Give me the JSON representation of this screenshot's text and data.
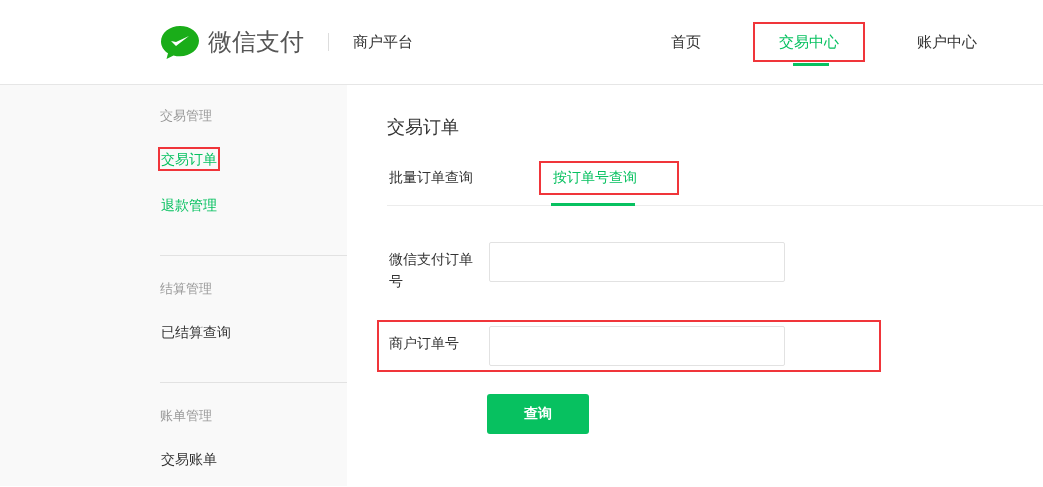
{
  "header": {
    "brand": "微信支付",
    "subtitle": "商户平台",
    "nav": [
      {
        "label": "首页",
        "selected": false,
        "highlighted": false
      },
      {
        "label": "交易中心",
        "selected": true,
        "highlighted": true
      },
      {
        "label": "账户中心",
        "selected": false,
        "highlighted": false
      }
    ]
  },
  "sidebar": {
    "groups": [
      {
        "title": "交易管理",
        "items": [
          {
            "label": "交易订单",
            "selected": true,
            "highlighted": true
          },
          {
            "label": "退款管理",
            "selected": true,
            "highlighted": false
          }
        ]
      },
      {
        "title": "结算管理",
        "items": [
          {
            "label": "已结算查询",
            "selected": false,
            "highlighted": false
          }
        ]
      },
      {
        "title": "账单管理",
        "items": [
          {
            "label": "交易账单",
            "selected": false,
            "highlighted": false
          }
        ]
      }
    ]
  },
  "main": {
    "title": "交易订单",
    "tabs": [
      {
        "label": "批量订单查询",
        "selected": false,
        "highlighted": false
      },
      {
        "label": "按订单号查询",
        "selected": true,
        "highlighted": true
      }
    ],
    "fields": [
      {
        "label": "微信支付订单号",
        "highlighted": false
      },
      {
        "label": "商户订单号",
        "highlighted": true
      }
    ],
    "submit": "查询"
  }
}
